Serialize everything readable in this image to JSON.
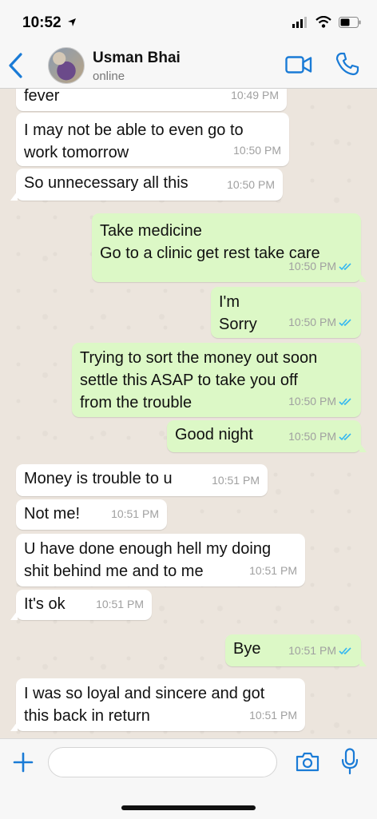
{
  "status": {
    "time": "10:52"
  },
  "header": {
    "contact_name": "Usman Bhai",
    "presence": "online"
  },
  "messages": [
    {
      "dir": "in",
      "text": "fever",
      "time": "10:49 PM"
    },
    {
      "dir": "in",
      "text": "I may not be able to even go to\nwork tomorrow",
      "time": "10:50 PM"
    },
    {
      "dir": "in",
      "text": "So unnecessary all this",
      "time": "10:50 PM"
    },
    {
      "dir": "out",
      "text": "Take medicine\nGo to a clinic get rest take care",
      "time": "10:50 PM",
      "read": true
    },
    {
      "dir": "out",
      "text": "I'm\nSorry",
      "time": "10:50 PM",
      "read": true
    },
    {
      "dir": "out",
      "text": "Trying to sort the money out soon\nsettle this ASAP to take you off\nfrom the trouble",
      "time": "10:50 PM",
      "read": true
    },
    {
      "dir": "out",
      "text": "Good night",
      "time": "10:50 PM",
      "read": true
    },
    {
      "dir": "in",
      "text": "Money is trouble to u",
      "time": "10:51 PM"
    },
    {
      "dir": "in",
      "text": "Not me!",
      "time": "10:51 PM"
    },
    {
      "dir": "in",
      "text": "U have done enough hell my doing\nshit behind me and to me",
      "time": "10:51 PM"
    },
    {
      "dir": "in",
      "text": "It's ok",
      "time": "10:51 PM"
    },
    {
      "dir": "out",
      "text": "Bye",
      "time": "10:51 PM",
      "read": true
    },
    {
      "dir": "in",
      "text": "I was so loyal and sincere and got\nthis back in return",
      "time": "10:51 PM"
    }
  ],
  "composer": {
    "value": "",
    "placeholder": ""
  },
  "colors": {
    "accent": "#1a7bd6",
    "outgoing_bubble": "#dcf8c6",
    "incoming_bubble": "#ffffff",
    "read_ticks": "#34b7f1"
  }
}
